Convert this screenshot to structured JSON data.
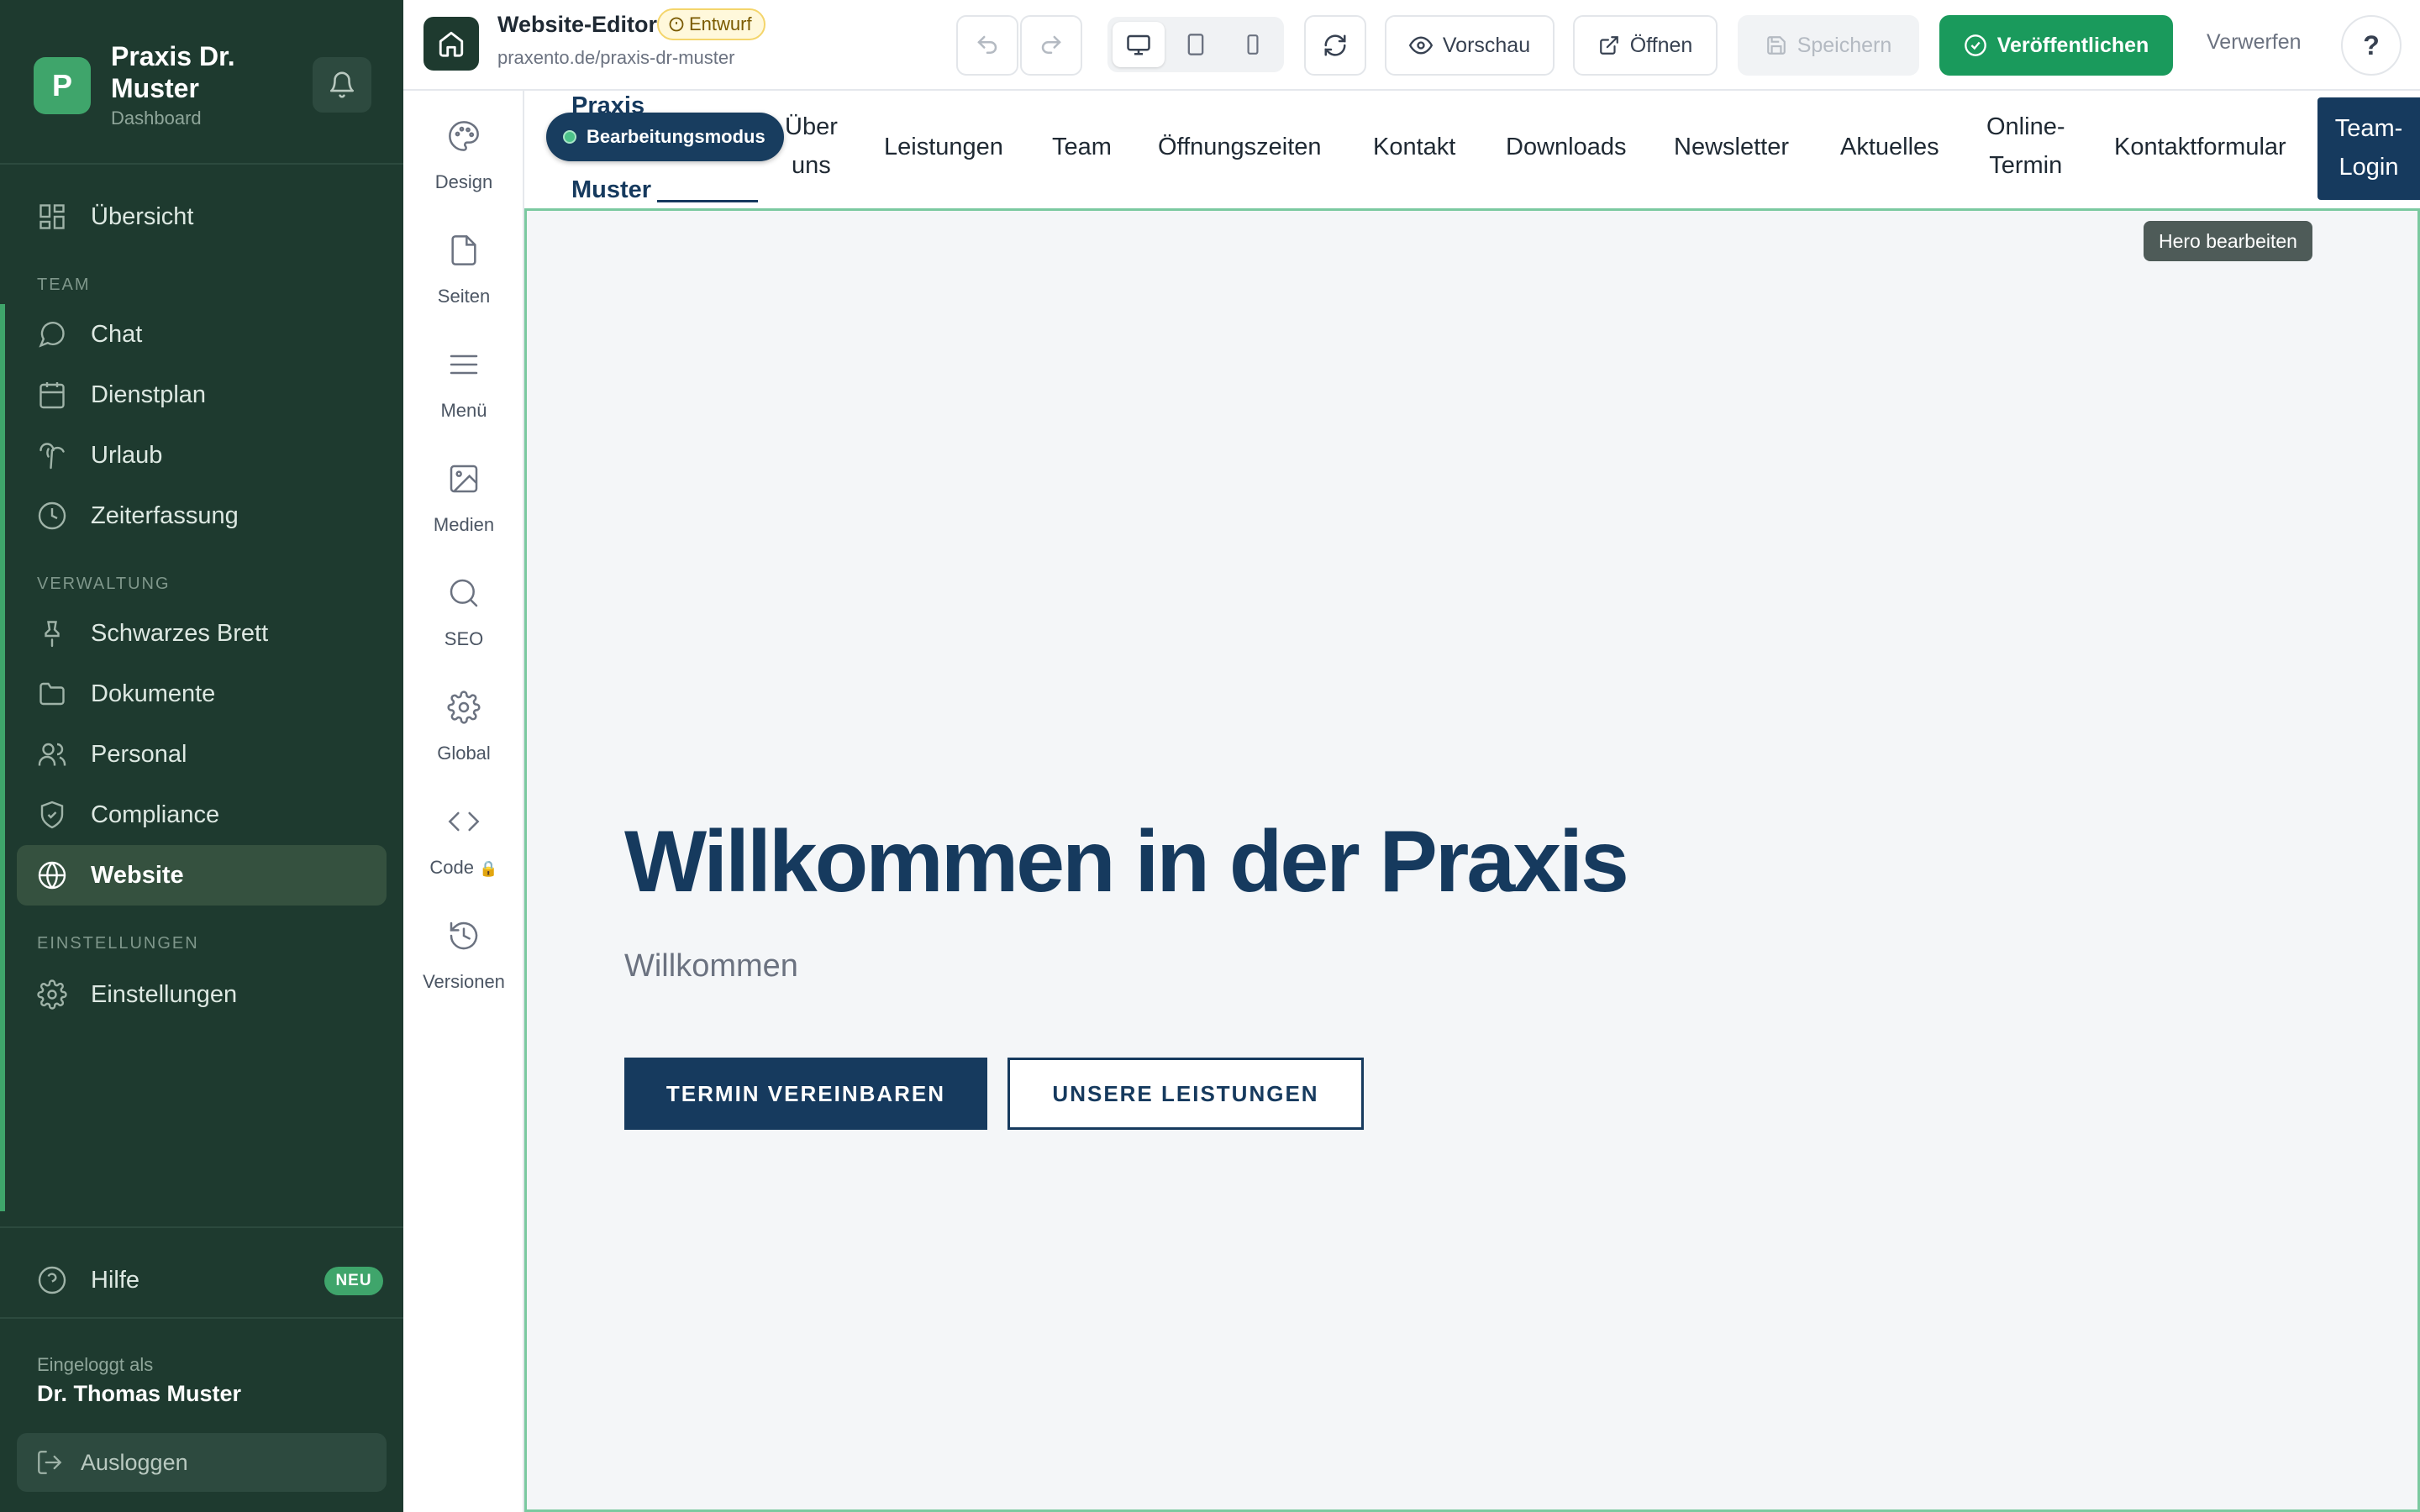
{
  "sidebar": {
    "brand": {
      "initial": "P",
      "name": "Praxis Dr. Muster",
      "subtitle": "Dashboard"
    },
    "overview": {
      "label": "Übersicht",
      "icon": "grid-icon"
    },
    "sections": {
      "team": "TEAM",
      "admin": "VERWALTUNG",
      "settings": "EINSTELLUNGEN"
    },
    "team_items": [
      {
        "label": "Chat",
        "icon": "chat-icon"
      },
      {
        "label": "Dienstplan",
        "icon": "calendar-icon"
      },
      {
        "label": "Urlaub",
        "icon": "palm-tree-icon"
      },
      {
        "label": "Zeiterfassung",
        "icon": "clock-icon"
      }
    ],
    "admin_items": [
      {
        "label": "Schwarzes Brett",
        "icon": "pin-icon"
      },
      {
        "label": "Dokumente",
        "icon": "folder-icon"
      },
      {
        "label": "Personal",
        "icon": "users-icon"
      },
      {
        "label": "Compliance",
        "icon": "shield-icon"
      },
      {
        "label": "Website",
        "icon": "globe-icon",
        "active": true
      }
    ],
    "settings_items": [
      {
        "label": "Einstellungen",
        "icon": "gear-icon"
      }
    ],
    "help": {
      "label": "Hilfe",
      "badge": "NEU"
    },
    "user": {
      "logged_in_label": "Eingeloggt als",
      "name": "Dr. Thomas Muster"
    },
    "logout_label": "Ausloggen"
  },
  "toolbar": {
    "title": "Website-Editor",
    "status_badge": "Entwurf",
    "url": "praxento.de/praxis-dr-muster",
    "preview_label": "Vorschau",
    "open_label": "Öffnen",
    "save_label": "Speichern",
    "publish_label": "Veröffentlichen",
    "discard_label": "Verwerfen",
    "help_label": "?"
  },
  "tools": [
    {
      "label": "Design",
      "icon": "palette-icon"
    },
    {
      "label": "Seiten",
      "icon": "page-icon"
    },
    {
      "label": "Menü",
      "icon": "menu-icon"
    },
    {
      "label": "Medien",
      "icon": "image-icon"
    },
    {
      "label": "SEO",
      "icon": "search-icon"
    },
    {
      "label": "Global",
      "icon": "gear-icon"
    },
    {
      "label": "Code",
      "icon": "code-icon",
      "locked": true
    },
    {
      "label": "Versionen",
      "icon": "history-icon"
    }
  ],
  "site": {
    "logo_line1": "Praxis",
    "logo_line2": "Muster",
    "edit_mode_label": "Bearbeitungsmodus",
    "nav": {
      "about_1": "Über",
      "about_2": "uns",
      "services": "Leistungen",
      "team": "Team",
      "hours": "Öffnungszeiten",
      "contact": "Kontakt",
      "downloads": "Downloads",
      "newsletter": "Newsletter",
      "news": "Aktuelles",
      "online_1": "Online-",
      "online_2": "Termin",
      "contact_form": "Kontaktformular",
      "login_1": "Team-",
      "login_2": "Login"
    },
    "hero": {
      "edit_tag": "Hero bearbeiten",
      "title": "Willkommen in der Praxis",
      "subtitle": "Willkommen",
      "primary_cta": "TERMIN VEREINBAREN",
      "secondary_cta": "UNSERE LEISTUNGEN"
    }
  },
  "colors": {
    "sidebar_bg": "#1e3a2f",
    "accent_green": "#3fa56b",
    "publish_green": "#1a9a5c",
    "site_navy": "#163a5e",
    "hero_bg": "#f4f6f8"
  }
}
